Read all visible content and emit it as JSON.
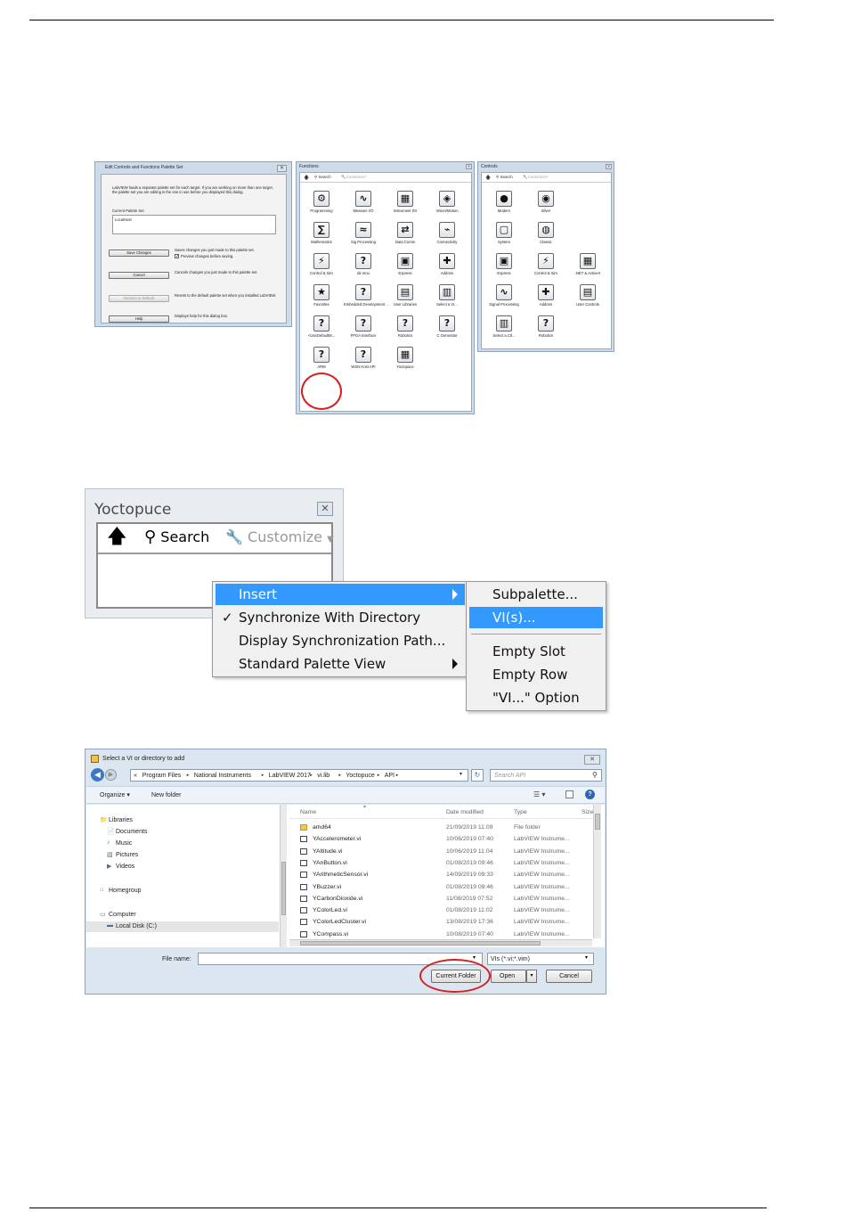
{
  "edit_dialog": {
    "title": "Edit Controls and Functions Palette Set",
    "intro": "LabVIEW loads a separate palette set for each target. If you are working on more than one target, the palette set you are editing is the one in use before you displayed this dialog.",
    "current_set_label": "Current Palette Set",
    "current_set_value": "LocalHost",
    "buttons": [
      {
        "label": "Save Changes",
        "desc": "Saves changes you just made to this palette set.",
        "disabled": false
      },
      {
        "label": "Cancel",
        "desc": "Cancels changes you just made to this palette set.",
        "disabled": false
      },
      {
        "label": "Restore to Default",
        "desc": "Resets to the default palette set when you installed LabVIEW.",
        "disabled": true
      },
      {
        "label": "Help",
        "desc": "Displays help for this dialog box.",
        "disabled": false
      }
    ],
    "preview_checkbox": "Preview changes before saving.",
    "preview_checked": true
  },
  "functions_palette": {
    "title": "Functions",
    "search": "Search",
    "customize": "Customize*",
    "items": [
      "Programming",
      "Measure I/O",
      "Instrument I/O",
      "Vision/Motion",
      "Mathematics",
      "Sig Processing",
      "Data Comm",
      "Connectivity",
      "Control & Sim",
      "dir.mnu",
      "Express",
      "Addons",
      "Favorites",
      "Embedded Development ...",
      "User Libraries",
      "Select a VI...",
      "<UseDefaultM...",
      "FPGA Interface",
      "Robotics",
      "C Generator",
      "ARM",
      "WSN Host API",
      "Yoctopuce"
    ]
  },
  "controls_palette": {
    "title": "Controls",
    "search": "Search",
    "customize": "Customize*",
    "items": [
      "Modern",
      "Silver",
      "System",
      "Classic",
      "Express",
      "Control & Sim",
      ".NET & ActiveX",
      "Signal Processing",
      "Addons",
      "User Controls",
      "Select a Ctl...",
      "Robotics"
    ]
  },
  "yocto_palette": {
    "title": "Yoctopuce",
    "search": "Search",
    "customize": "Customize"
  },
  "context_menu": {
    "items": [
      {
        "label": "Insert",
        "highlighted": true,
        "submenu": true,
        "checked": false
      },
      {
        "label": "Synchronize With Directory",
        "highlighted": false,
        "submenu": false,
        "checked": true
      },
      {
        "label": "Display Synchronization Path...",
        "highlighted": false,
        "submenu": false,
        "checked": false
      },
      {
        "label": "Standard Palette View",
        "highlighted": false,
        "submenu": true,
        "checked": false
      }
    ],
    "check_mark": "✓",
    "submenu": [
      "Subpalette...",
      "VI(s)...",
      "Empty Slot",
      "Empty Row",
      "\"VI...\" Option"
    ]
  },
  "file_dialog": {
    "title": "Select a VI or directory to add",
    "breadcrumb": [
      "«",
      "Program Files",
      "National Instruments",
      "LabVIEW 2017",
      "vi.lib",
      "Yoctopuce",
      "API"
    ],
    "search_placeholder": "Search API",
    "organize": "Organize ▾",
    "new_folder": "New folder",
    "nav": [
      {
        "label": "Libraries",
        "indent": 0
      },
      {
        "label": "Documents",
        "indent": 1
      },
      {
        "label": "Music",
        "indent": 1
      },
      {
        "label": "Pictures",
        "indent": 1
      },
      {
        "label": "Videos",
        "indent": 1
      },
      {
        "label": "Homegroup",
        "indent": 0
      },
      {
        "label": "Computer",
        "indent": 0
      },
      {
        "label": "Local Disk (C:)",
        "indent": 1
      }
    ],
    "columns": [
      "Name",
      "Date modified",
      "Type",
      "Size"
    ],
    "files": [
      {
        "name": "amd64",
        "date": "21/09/2019 11:09",
        "type": "File folder",
        "folder": true
      },
      {
        "name": "YAccelerometer.vi",
        "date": "10/06/2019 07:40",
        "type": "LabVIEW Instrume...",
        "folder": false
      },
      {
        "name": "YAltitude.vi",
        "date": "10/06/2019 11:04",
        "type": "LabVIEW Instrume...",
        "folder": false
      },
      {
        "name": "YAnButton.vi",
        "date": "01/08/2019 09:46",
        "type": "LabVIEW Instrume...",
        "folder": false
      },
      {
        "name": "YArithmeticSensor.vi",
        "date": "14/09/2019 09:33",
        "type": "LabVIEW Instrume...",
        "folder": false
      },
      {
        "name": "YBuzzer.vi",
        "date": "01/08/2019 09:46",
        "type": "LabVIEW Instrume...",
        "folder": false
      },
      {
        "name": "YCarbonDioxide.vi",
        "date": "11/08/2019 07:52",
        "type": "LabVIEW Instrume...",
        "folder": false
      },
      {
        "name": "YColorLed.vi",
        "date": "01/08/2019 11:02",
        "type": "LabVIEW Instrume...",
        "folder": false
      },
      {
        "name": "YColorLedCluster.vi",
        "date": "13/08/2019 17:36",
        "type": "LabVIEW Instrume...",
        "folder": false
      },
      {
        "name": "YCompass.vi",
        "date": "10/08/2019 07:40",
        "type": "LabVIEW Instrume...",
        "folder": false
      }
    ],
    "filename_label": "File name:",
    "filename_value": "",
    "filter": "VIs (*.vi;*.vim)",
    "buttons": {
      "current_folder": "Current Folder",
      "open": "Open",
      "cancel": "Cancel"
    }
  },
  "colors": {
    "highlight": "#3399ff",
    "circle": "#d42020",
    "window": "#cfdbe8"
  }
}
